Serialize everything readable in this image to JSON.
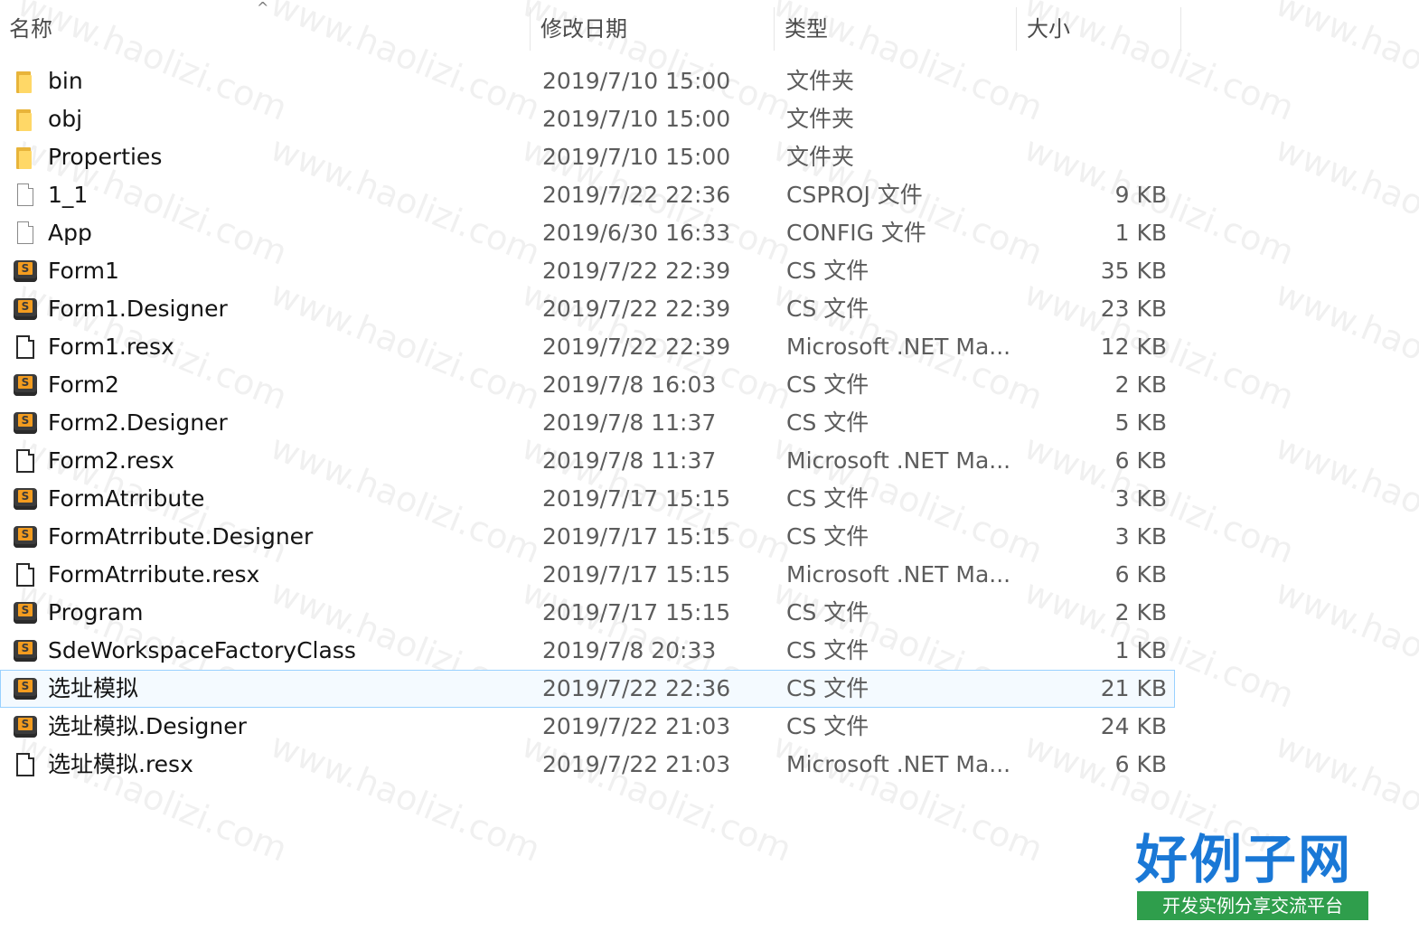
{
  "columns": {
    "name": "名称",
    "date": "修改日期",
    "type": "类型",
    "size": "大小"
  },
  "sort_indicator": "^",
  "selected_row_index": 16,
  "files": [
    {
      "name": "bin",
      "date": "2019/7/10 15:00",
      "type": "文件夹",
      "size": "",
      "icon": "folder-icon"
    },
    {
      "name": "obj",
      "date": "2019/7/10 15:00",
      "type": "文件夹",
      "size": "",
      "icon": "folder-icon"
    },
    {
      "name": "Properties",
      "date": "2019/7/10 15:00",
      "type": "文件夹",
      "size": "",
      "icon": "folder-icon"
    },
    {
      "name": "1_1",
      "date": "2019/7/22 22:36",
      "type": "CSPROJ 文件",
      "size": "9 KB",
      "icon": "file-icon"
    },
    {
      "name": "App",
      "date": "2019/6/30 16:33",
      "type": "CONFIG 文件",
      "size": "1 KB",
      "icon": "file-icon"
    },
    {
      "name": "Form1",
      "date": "2019/7/22 22:39",
      "type": "CS 文件",
      "size": "35 KB",
      "icon": "cs-file-icon"
    },
    {
      "name": "Form1.Designer",
      "date": "2019/7/22 22:39",
      "type": "CS 文件",
      "size": "23 KB",
      "icon": "cs-file-icon"
    },
    {
      "name": "Form1.resx",
      "date": "2019/7/22 22:39",
      "type": "Microsoft .NET Ma...",
      "size": "12 KB",
      "icon": "resx-file-icon"
    },
    {
      "name": "Form2",
      "date": "2019/7/8 16:03",
      "type": "CS 文件",
      "size": "2 KB",
      "icon": "cs-file-icon"
    },
    {
      "name": "Form2.Designer",
      "date": "2019/7/8 11:37",
      "type": "CS 文件",
      "size": "5 KB",
      "icon": "cs-file-icon"
    },
    {
      "name": "Form2.resx",
      "date": "2019/7/8 11:37",
      "type": "Microsoft .NET Ma...",
      "size": "6 KB",
      "icon": "resx-file-icon"
    },
    {
      "name": "FormAtrribute",
      "date": "2019/7/17 15:15",
      "type": "CS 文件",
      "size": "3 KB",
      "icon": "cs-file-icon"
    },
    {
      "name": "FormAtrribute.Designer",
      "date": "2019/7/17 15:15",
      "type": "CS 文件",
      "size": "3 KB",
      "icon": "cs-file-icon"
    },
    {
      "name": "FormAtrribute.resx",
      "date": "2019/7/17 15:15",
      "type": "Microsoft .NET Ma...",
      "size": "6 KB",
      "icon": "resx-file-icon"
    },
    {
      "name": "Program",
      "date": "2019/7/17 15:15",
      "type": "CS 文件",
      "size": "2 KB",
      "icon": "cs-file-icon"
    },
    {
      "name": "SdeWorkspaceFactoryClass",
      "date": "2019/7/8 20:33",
      "type": "CS 文件",
      "size": "1 KB",
      "icon": "cs-file-icon"
    },
    {
      "name": "选址模拟",
      "date": "2019/7/22 22:36",
      "type": "CS 文件",
      "size": "21 KB",
      "icon": "cs-file-icon"
    },
    {
      "name": "选址模拟.Designer",
      "date": "2019/7/22 21:03",
      "type": "CS 文件",
      "size": "24 KB",
      "icon": "cs-file-icon"
    },
    {
      "name": "选址模拟.resx",
      "date": "2019/7/22 21:03",
      "type": "Microsoft .NET Ma...",
      "size": "6 KB",
      "icon": "resx-file-icon"
    }
  ],
  "watermark_text": "www.haolizi.com",
  "logo": {
    "main": "好例子网",
    "sub": "开发实例分享交流平台"
  },
  "colors": {
    "selection_border": "#99d1ff",
    "selection_fill": "#f4faff",
    "folder": "#ffd867",
    "cs_icon_accent": "#f39c1f",
    "logo_blue": "#1a78d6",
    "logo_green": "#2f9e4c"
  }
}
